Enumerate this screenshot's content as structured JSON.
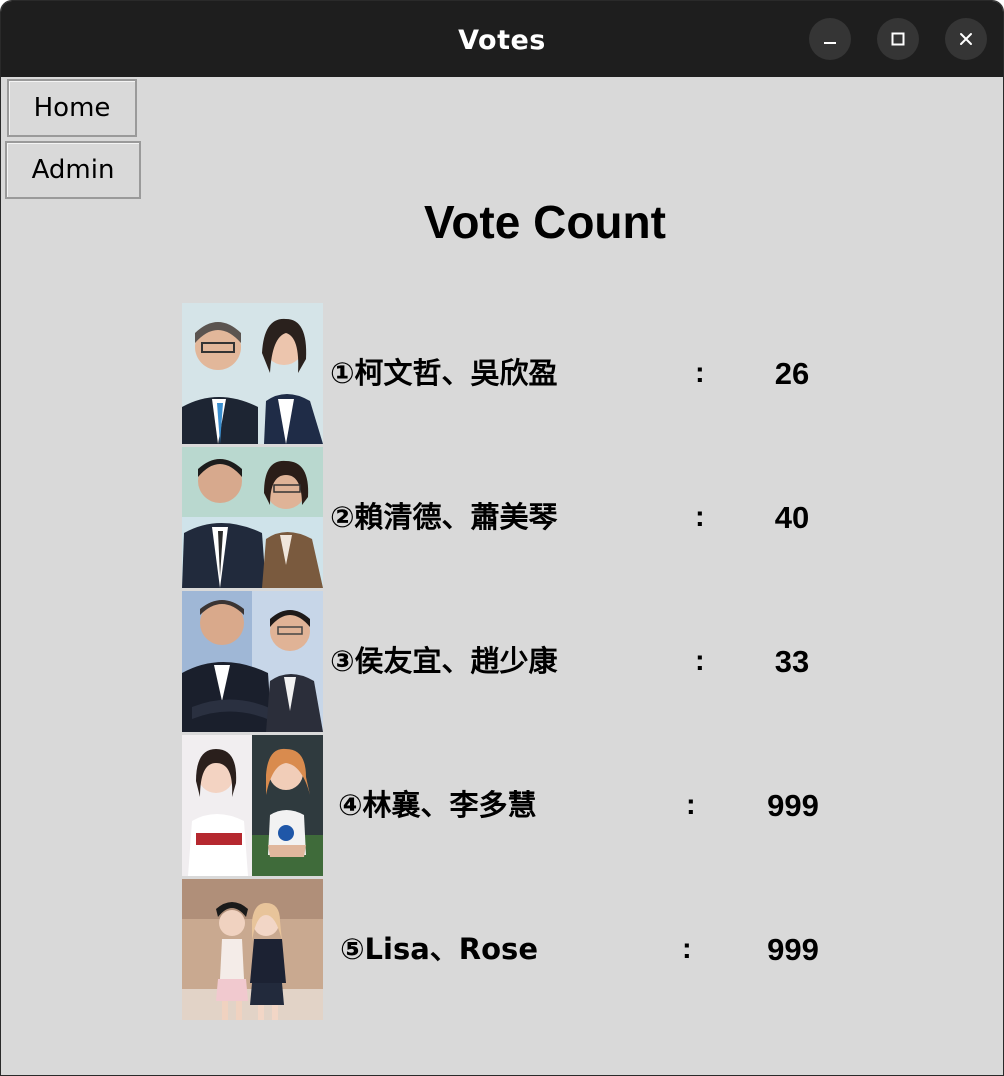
{
  "window": {
    "title": "Votes",
    "controls": {
      "minimize_icon": "minimize-icon",
      "maximize_icon": "maximize-icon",
      "close_icon": "close-icon"
    }
  },
  "nav": {
    "home_label": "Home",
    "admin_label": "Admin"
  },
  "main": {
    "heading": "Vote Count",
    "separator": ":",
    "candidates": [
      {
        "name": "①柯文哲、吳欣盈",
        "votes": "26"
      },
      {
        "name": "②賴清德、蕭美琴",
        "votes": "40"
      },
      {
        "name": "③侯友宜、趙少康",
        "votes": "33"
      },
      {
        "name": "④林襄、李多慧",
        "votes": "999"
      },
      {
        "name": "⑤Lisa、Rose",
        "votes": "999"
      }
    ]
  },
  "colors": {
    "titlebar": "#1e1e1e",
    "background": "#d9d9d9"
  }
}
